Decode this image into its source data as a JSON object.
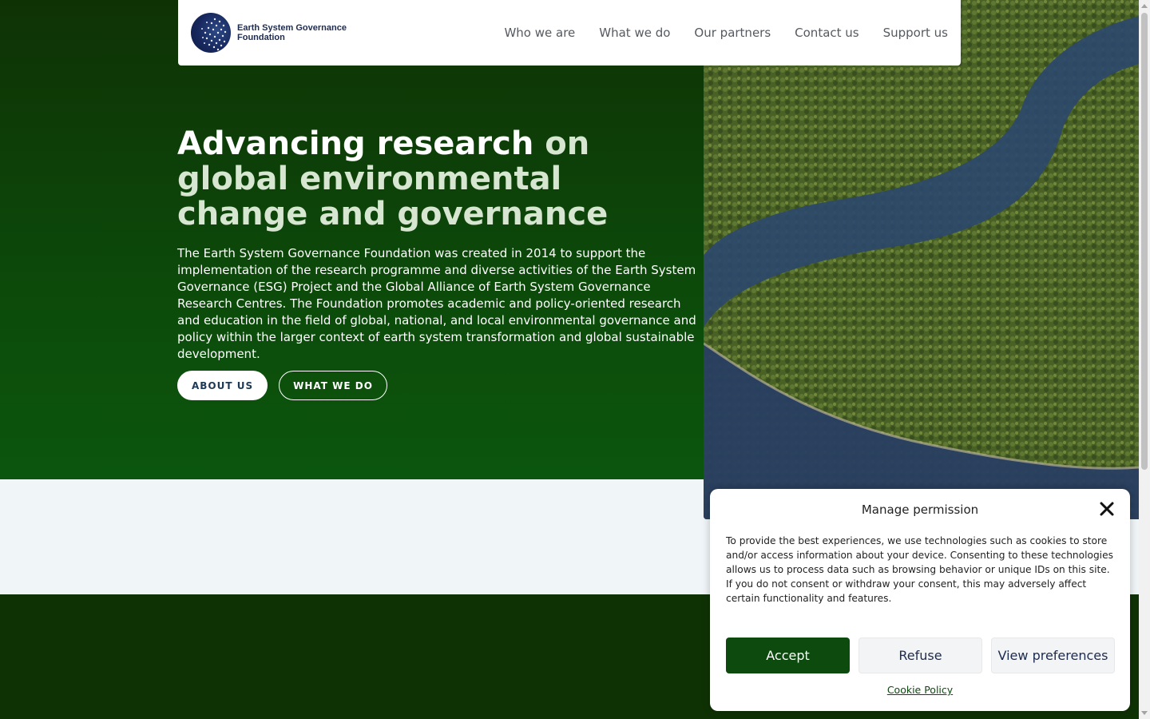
{
  "header": {
    "logo_text_line1": "Earth System Governance",
    "logo_text_line2": "Foundation",
    "nav": [
      {
        "label": "Who we are"
      },
      {
        "label": "What we do"
      },
      {
        "label": "Our partners"
      },
      {
        "label": "Contact us"
      },
      {
        "label": "Support us"
      }
    ]
  },
  "hero": {
    "title_bold": "Advancing research",
    "title_light": "on global environmental change and governance",
    "description": "The Earth System Governance Foundation was created in 2014 to support the implementation of the research programme and diverse activities of the Earth System Governance (ESG) Project and the Global Alliance of Earth System Governance Research Centres. The Foundation promotes academic and policy-oriented research and education in the field of global, national, and local environmental governance and policy within the larger context of earth system transformation and global sustainable development.",
    "btn_about": "ABOUT US",
    "btn_what": "WHAT WE DO"
  },
  "cookie": {
    "title": "Manage permission",
    "text": "To provide the best experiences, we use technologies such as cookies to store and/or access information about your device. Consenting to these technologies allows us to process data such as browsing behavior or unique IDs on this site. If you do not consent or withdraw your consent, this may adversely affect certain functionality and features.",
    "accept": "Accept",
    "refuse": "Refuse",
    "preferences": "View preferences",
    "policy_link": "Cookie Policy"
  },
  "colors": {
    "brand_green": "#0c4a0e",
    "dark_green": "#0f3205",
    "navy": "#1d2b4e"
  }
}
